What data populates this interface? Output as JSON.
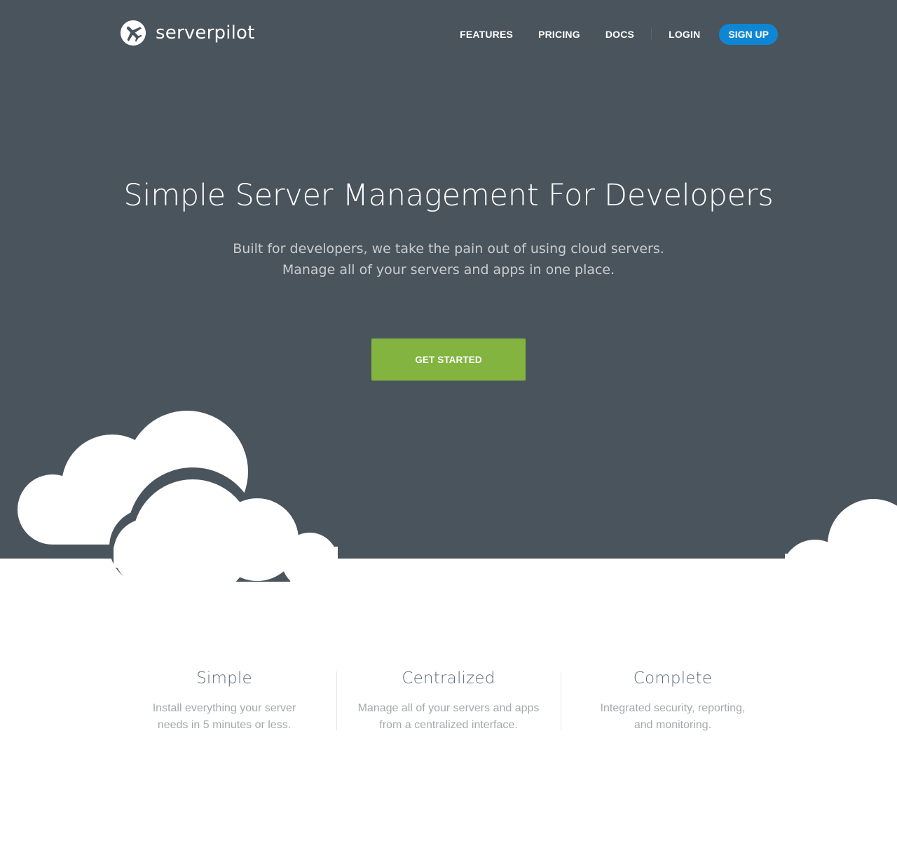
{
  "brand": {
    "name": "serverpilot",
    "icon": "airplane-icon",
    "color": "#4a545c"
  },
  "nav": {
    "features": "FEATURES",
    "pricing": "PRICING",
    "docs": "DOCS",
    "login": "LOGIN",
    "signup": "SIGN UP",
    "signup_color": "#0e86d4"
  },
  "hero": {
    "title": "Simple Server Management For Developers",
    "subtitle_line1": "Built for developers, we take the pain out of using cloud servers.",
    "subtitle_line2": "Manage all of your servers and apps in one place.",
    "cta": "GET STARTED",
    "cta_color": "#83b440"
  },
  "features": [
    {
      "title": "Simple",
      "desc_line1": "Install everything your server",
      "desc_line2": "needs in 5 minutes or less."
    },
    {
      "title": "Centralized",
      "desc_line1": "Manage all of your servers and apps",
      "desc_line2": "from a centralized interface."
    },
    {
      "title": "Complete",
      "desc_line1": "Integrated security, reporting,",
      "desc_line2": "and monitoring."
    }
  ]
}
